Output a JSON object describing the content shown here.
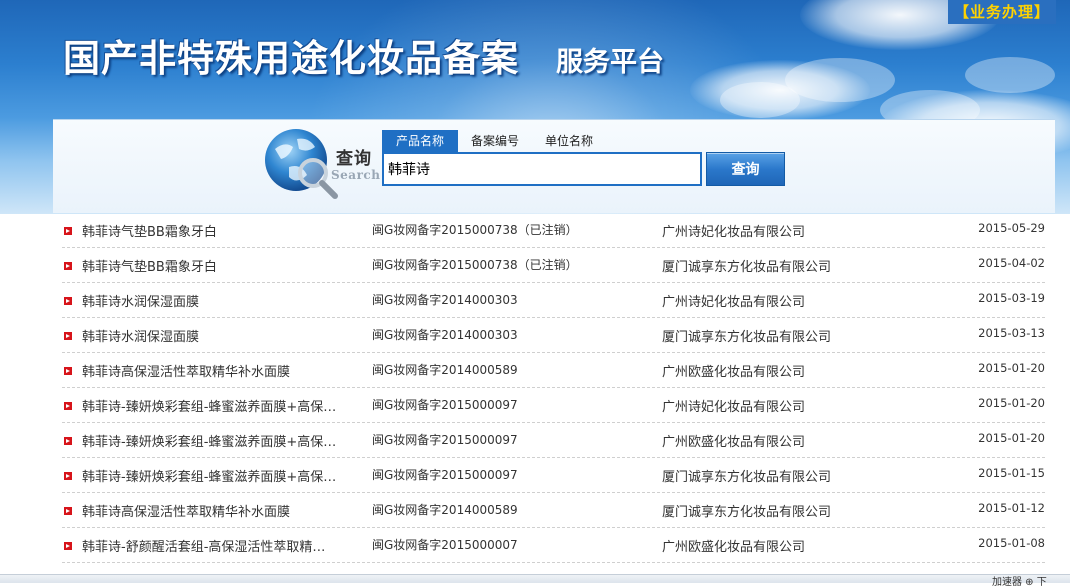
{
  "header": {
    "title": "国产非特殊用途化妆品备案",
    "subtitle": "服务平台",
    "biz_link": "【业务办理】"
  },
  "search": {
    "logo_label": "查询",
    "logo_label_en": "Search",
    "tabs": [
      {
        "label": "产品名称",
        "active": true
      },
      {
        "label": "备案编号",
        "active": false
      },
      {
        "label": "单位名称",
        "active": false
      }
    ],
    "query": "韩菲诗",
    "button_label": "查询"
  },
  "results": [
    {
      "name": "韩菲诗气垫BB霜象牙白",
      "reg": "闽G妆网备字2015000738（已注销）",
      "company": "广州诗妃化妆品有限公司",
      "date": "2015-05-29"
    },
    {
      "name": "韩菲诗气垫BB霜象牙白",
      "reg": "闽G妆网备字2015000738（已注销）",
      "company": "厦门诚享东方化妆品有限公司",
      "date": "2015-04-02"
    },
    {
      "name": "韩菲诗水润保湿面膜",
      "reg": "闽G妆网备字2014000303",
      "company": "广州诗妃化妆品有限公司",
      "date": "2015-03-19"
    },
    {
      "name": "韩菲诗水润保湿面膜",
      "reg": "闽G妆网备字2014000303",
      "company": "厦门诚享东方化妆品有限公司",
      "date": "2015-03-13"
    },
    {
      "name": "韩菲诗高保湿活性萃取精华补水面膜",
      "reg": "闽G妆网备字2014000589",
      "company": "广州欧盛化妆品有限公司",
      "date": "2015-01-20"
    },
    {
      "name": "韩菲诗-臻妍焕彩套组-蜂蜜滋养面膜+高保…",
      "reg": "闽G妆网备字2015000097",
      "company": "广州诗妃化妆品有限公司",
      "date": "2015-01-20"
    },
    {
      "name": "韩菲诗-臻妍焕彩套组-蜂蜜滋养面膜+高保…",
      "reg": "闽G妆网备字2015000097",
      "company": "广州欧盛化妆品有限公司",
      "date": "2015-01-20"
    },
    {
      "name": "韩菲诗-臻妍焕彩套组-蜂蜜滋养面膜+高保…",
      "reg": "闽G妆网备字2015000097",
      "company": "厦门诚享东方化妆品有限公司",
      "date": "2015-01-15"
    },
    {
      "name": "韩菲诗高保湿活性萃取精华补水面膜",
      "reg": "闽G妆网备字2014000589",
      "company": "厦门诚享东方化妆品有限公司",
      "date": "2015-01-12"
    },
    {
      "name": "韩菲诗-舒颜醒活套组-高保湿活性萃取精…",
      "reg": "闽G妆网备字2015000007",
      "company": "广州欧盛化妆品有限公司",
      "date": "2015-01-08"
    }
  ],
  "statusbar": {
    "text": "加速器 ⊕ 下"
  },
  "colors": {
    "brand_blue": "#1f6fc4",
    "bullet_red": "#d7141a",
    "link_yellow": "#ffd200"
  }
}
